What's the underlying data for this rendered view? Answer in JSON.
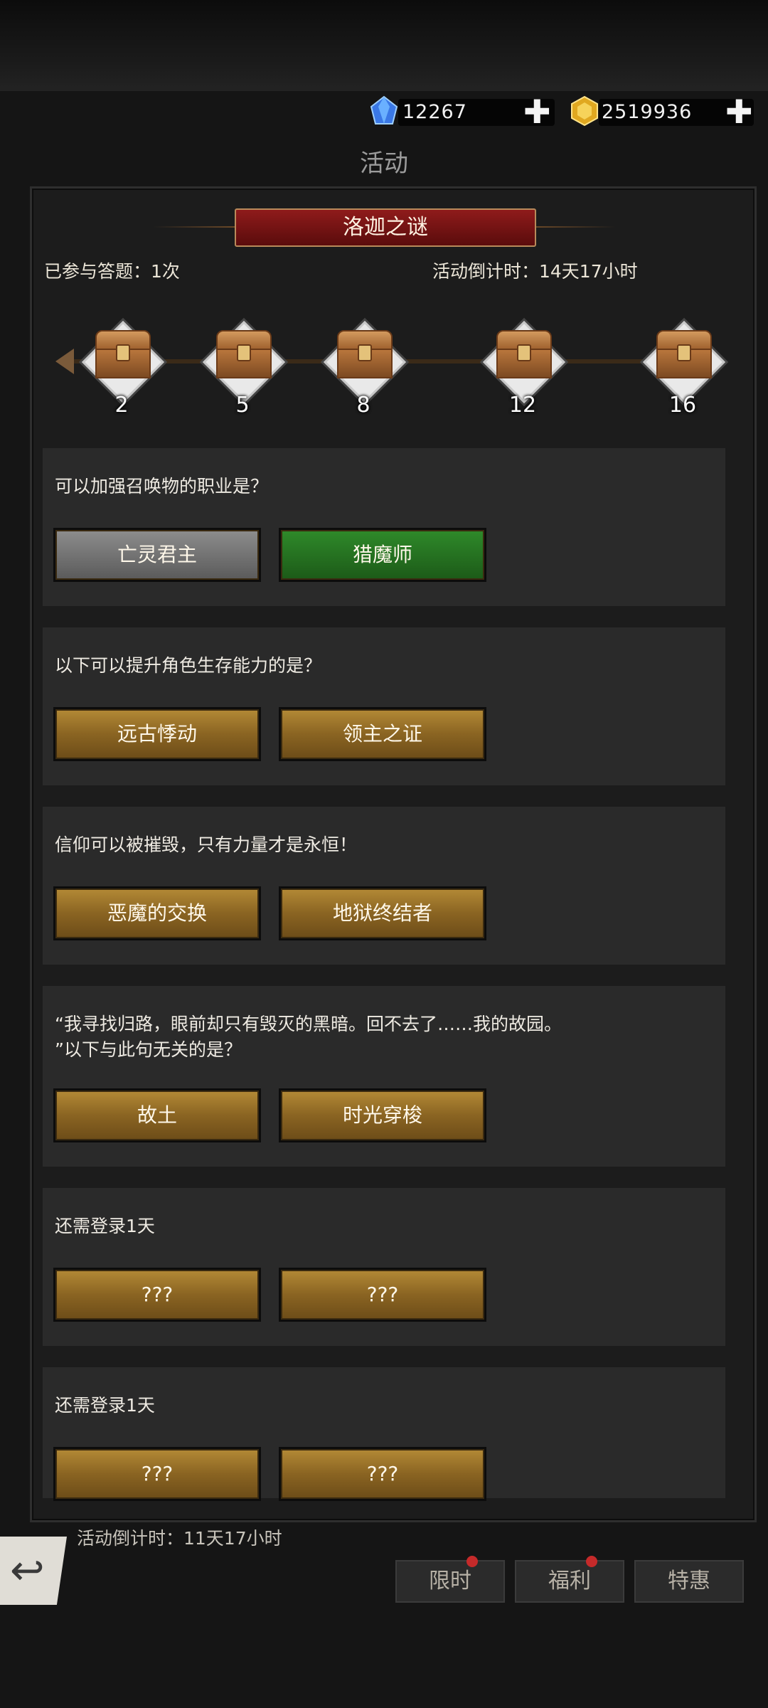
{
  "header": {
    "diamonds": "12267",
    "gold": "2519936",
    "plus_symbol": "✚",
    "page_title": "活动"
  },
  "event": {
    "banner_title": "洛迦之谜",
    "participated": "已参与答题：1次",
    "countdown": "活动倒计时：14天17小时"
  },
  "chests": [
    {
      "count": "2"
    },
    {
      "count": "5"
    },
    {
      "count": "8"
    },
    {
      "count": "12"
    },
    {
      "count": "16"
    }
  ],
  "questions": [
    {
      "text": "可以加强召唤物的职业是？",
      "options": [
        "亡灵君主",
        "猎魔师"
      ],
      "option_states": [
        "wrong",
        "correct"
      ]
    },
    {
      "text": "以下可以提升角色生存能力的是？",
      "options": [
        "远古悸动",
        "领主之证"
      ],
      "option_states": [
        "normal",
        "normal"
      ]
    },
    {
      "text": "信仰可以被摧毁，只有力量才是永恒！",
      "options": [
        "恶魔的交换",
        "地狱终结者"
      ],
      "option_states": [
        "normal",
        "normal"
      ]
    },
    {
      "text_line1": "“我寻找归路，眼前却只有毁灭的黑暗。回不去了……我的故园。",
      "text_line2": "”以下与此句无关的是？",
      "options": [
        "故土",
        "时光穿梭"
      ],
      "option_states": [
        "normal",
        "normal"
      ]
    },
    {
      "text": "还需登录1天",
      "options": [
        "???",
        "???"
      ],
      "option_states": [
        "locked",
        "locked"
      ]
    },
    {
      "text": "还需登录1天",
      "options": [
        "???",
        "???"
      ],
      "option_states": [
        "locked",
        "locked"
      ]
    }
  ],
  "footer": {
    "countdown2": "活动倒计时：11天17小时",
    "tabs": [
      "限时",
      "福利",
      "特惠"
    ]
  },
  "colors": {
    "gold_button": "#8a6422",
    "correct_button": "#2f8a2a",
    "wrong_button": "#6e6e6e",
    "banner_red": "#7a1414"
  },
  "icons": [
    "blue-gem-icon",
    "gold-gem-icon",
    "plus-icon",
    "treasure-chest-icon",
    "back-arrow-icon",
    "notification-dot-icon"
  ]
}
